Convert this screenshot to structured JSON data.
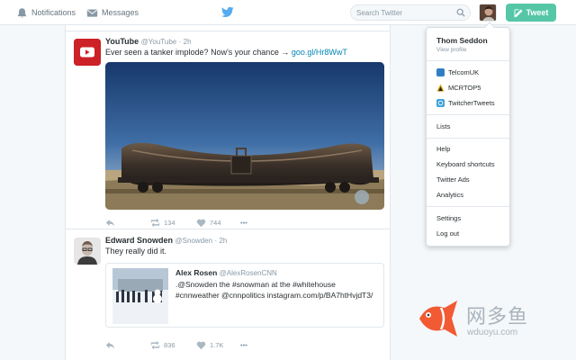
{
  "nav": {
    "notifications_label": "Notifications",
    "messages_label": "Messages",
    "notifications_icon": "bell-icon",
    "messages_icon": "envelope-icon",
    "logo_icon": "twitter-bird-icon"
  },
  "search": {
    "placeholder": "Search Twitter",
    "value": ""
  },
  "tweet_button": {
    "label": "Tweet",
    "color": "#55c7a7"
  },
  "tweets": [
    {
      "name": "YouTube",
      "handle": "@YouTube",
      "time": "· 2h",
      "text": "Ever seen a tanker implode? Now's your chance → ",
      "link": "goo.gl/Hr8WwT",
      "retweets": "134",
      "likes": "744",
      "more": "•••"
    },
    {
      "name": "Edward Snowden",
      "handle": "@Snowden",
      "time": "· 2h",
      "text": "They really did it.",
      "quote": {
        "name": "Alex Rosen",
        "handle": "@AlexRosenCNN",
        "text": ".@Snowden the #snowman at the #whitehouse #cnnweather @cnnpolitics instagram.com/p/BA7htHvjdT3/"
      },
      "retweets": "836",
      "likes": "1.7K",
      "more": "•••"
    }
  ],
  "dropdown": {
    "user_name": "Thom Seddon",
    "user_sub": "View profile",
    "accounts": [
      {
        "label": "TelcomUK",
        "color": "#2e7fc4"
      },
      {
        "label": "MCRTOP5",
        "color": "#e0a800"
      },
      {
        "label": "TwitcherTweets",
        "color": "#3aa0d8"
      }
    ],
    "lists_label": "Lists",
    "help_label": "Help",
    "shortcuts_label": "Keyboard shortcuts",
    "ads_label": "Twitter Ads",
    "analytics_label": "Analytics",
    "settings_label": "Settings",
    "logout_label": "Log out"
  },
  "watermark": {
    "cn": "网多鱼",
    "url": "wduoyu.com"
  },
  "colors": {
    "twitter_blue": "#55acee",
    "link": "#0084b4",
    "youtube_red": "#cc2127"
  }
}
